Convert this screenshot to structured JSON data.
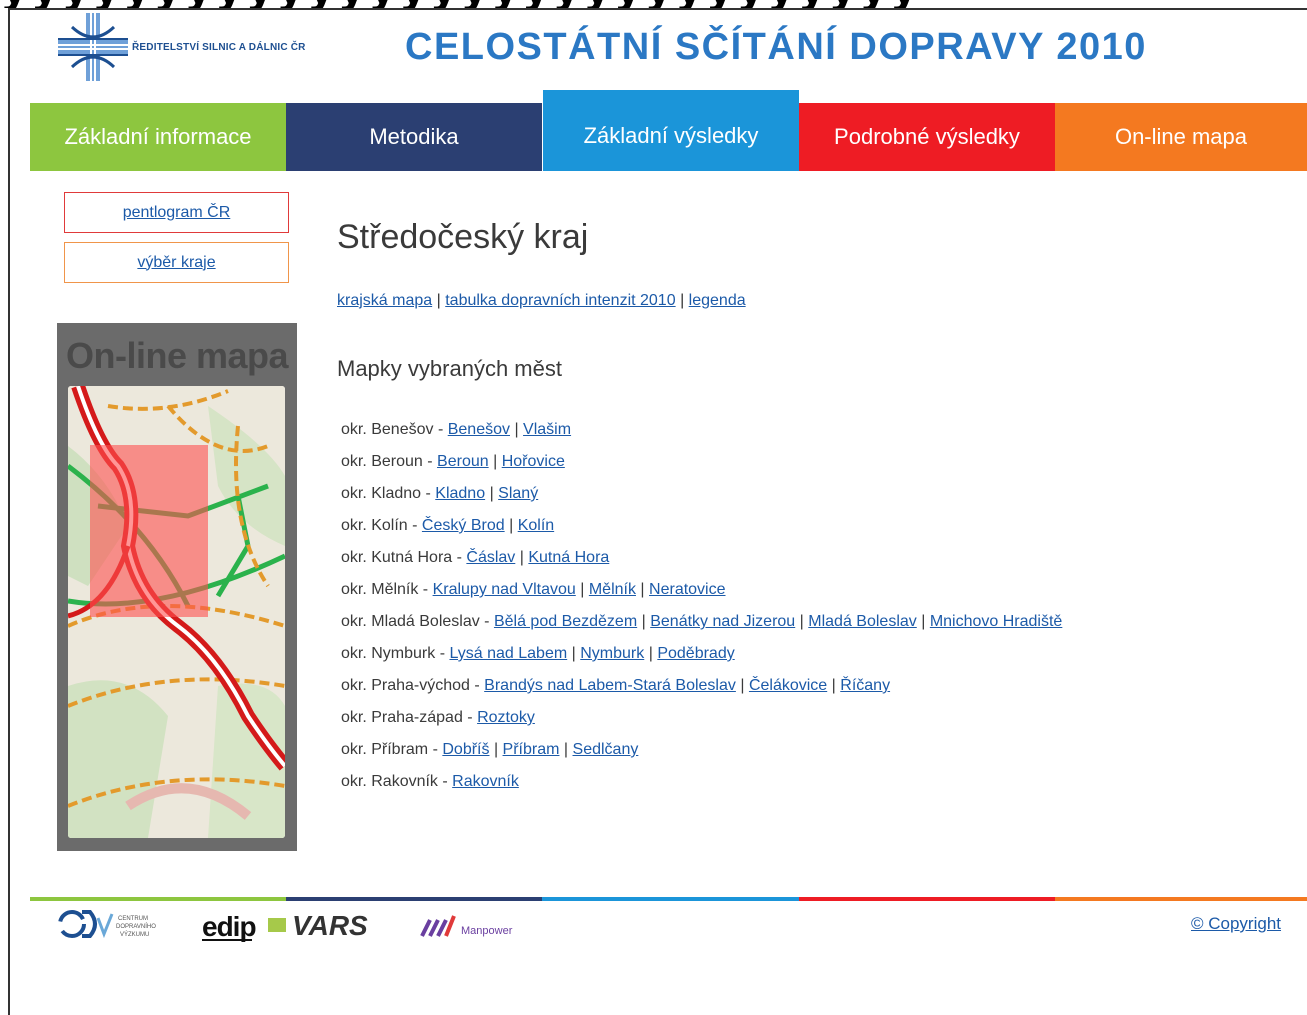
{
  "header": {
    "logo_text": "ŘEDITELSTVÍ SILNIC A DÁLNIC ČR",
    "site_title": "CELOSTÁTNÍ  SČÍTÁNÍ  DOPRAVY  2010"
  },
  "nav": {
    "items": [
      {
        "label": "Základní informace",
        "color": "#8dc63f"
      },
      {
        "label": "Metodika",
        "color": "#2b3f72"
      },
      {
        "label": "Základní výsledky",
        "color": "#1b95d9",
        "active": true
      },
      {
        "label": "Podrobné výsledky",
        "color": "#ee1c24"
      },
      {
        "label": "On-line mapa",
        "color": "#f47920"
      }
    ]
  },
  "sidebar": {
    "buttons": [
      {
        "label": "pentlogram ČR",
        "border": "#e03a3a"
      },
      {
        "label": "výběr kraje",
        "border": "#f0954a"
      }
    ],
    "map_title": "On-line mapa"
  },
  "main": {
    "region_title": "Středočeský kraj",
    "links": [
      "krajská mapa",
      "tabulka dopravních intenzit 2010",
      "legenda"
    ],
    "separator": "|",
    "subhead": "Mapky vybraných měst",
    "districts": [
      {
        "name": "okr. Benešov",
        "towns": [
          "Benešov",
          "Vlašim"
        ]
      },
      {
        "name": "okr. Beroun",
        "towns": [
          "Beroun",
          "Hořovice"
        ]
      },
      {
        "name": "okr. Kladno",
        "towns": [
          "Kladno",
          "Slaný"
        ]
      },
      {
        "name": "okr. Kolín",
        "towns": [
          "Český Brod",
          "Kolín"
        ]
      },
      {
        "name": "okr. Kutná Hora",
        "towns": [
          "Čáslav",
          "Kutná Hora"
        ]
      },
      {
        "name": "okr. Mělník",
        "towns": [
          "Kralupy nad Vltavou",
          "Mělník",
          "Neratovice"
        ]
      },
      {
        "name": "okr. Mladá Boleslav",
        "towns": [
          "Bělá pod Bezdězem",
          "Benátky nad Jizerou",
          "Mladá Boleslav",
          "Mnichovo Hradiště"
        ]
      },
      {
        "name": "okr. Nymburk",
        "towns": [
          "Lysá nad Labem",
          "Nymburk",
          "Poděbrady"
        ]
      },
      {
        "name": "okr. Praha-východ",
        "towns": [
          "Brandýs nad Labem-Stará Boleslav",
          "Čelákovice",
          "Říčany"
        ]
      },
      {
        "name": "okr. Praha-západ",
        "towns": [
          "Roztoky"
        ]
      },
      {
        "name": "okr. Příbram",
        "towns": [
          "Dobříš",
          "Příbram",
          "Sedlčany"
        ]
      },
      {
        "name": "okr. Rakovník",
        "towns": [
          "Rakovník"
        ]
      }
    ]
  },
  "footer": {
    "logos": [
      "CENTRUM DOPRAVNÍHO VÝZKUMU",
      "edip",
      "VARS",
      "Manpower"
    ],
    "copyright": "© Copyright"
  }
}
